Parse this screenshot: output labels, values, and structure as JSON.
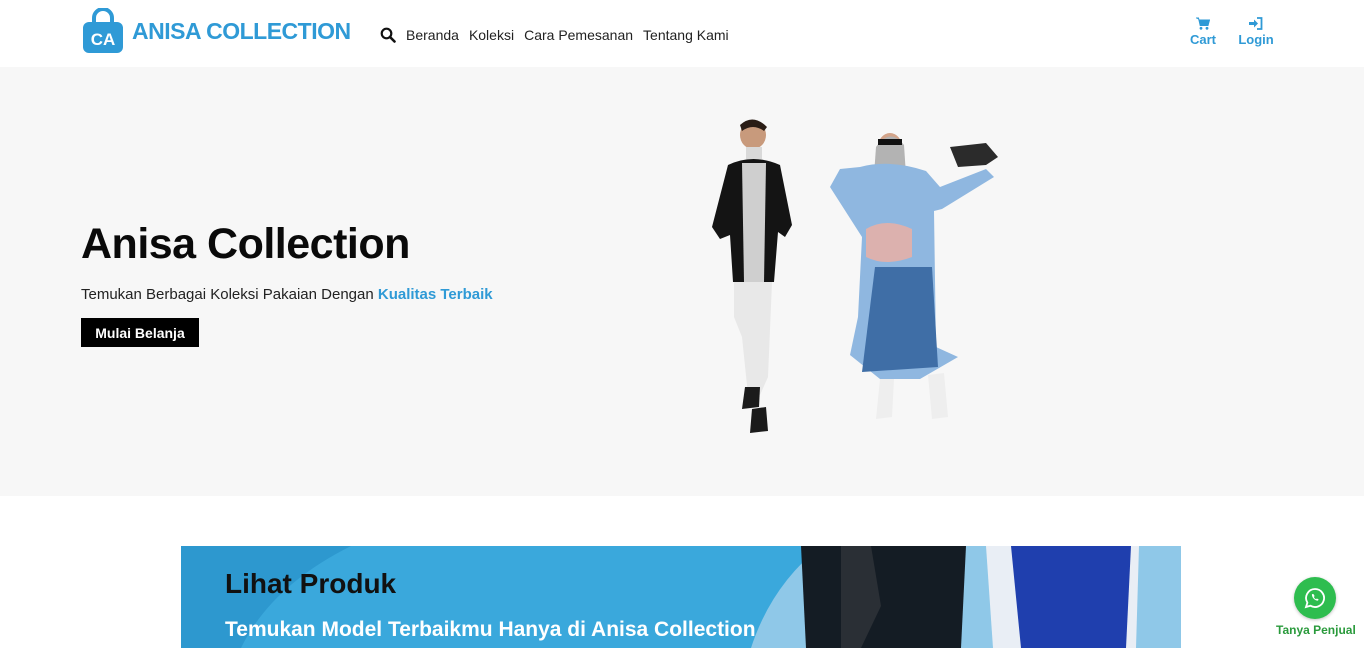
{
  "brand": {
    "name": "ANISA COLLECTION",
    "monogram": "CA",
    "color": "#2f9ad6"
  },
  "nav": {
    "search_icon": "search-icon",
    "items": [
      "Beranda",
      "Koleksi",
      "Cara Pemesanan",
      "Tentang Kami"
    ]
  },
  "actions": {
    "cart": {
      "label": "Cart",
      "icon": "cart-icon"
    },
    "login": {
      "label": "Login",
      "icon": "sign-in-icon"
    }
  },
  "hero": {
    "title": "Anisa Collection",
    "subtitle_prefix": "Temukan Berbagai Koleksi Pakaian Dengan ",
    "subtitle_highlight": "Kualitas Terbaik",
    "cta": "Mulai Belanja",
    "background": "#f7f7f7"
  },
  "banner": {
    "title": "Lihat Produk",
    "subtitle": "Temukan Model Terbaikmu Hanya di Anisa Collection",
    "background": "#3aa8dc"
  },
  "chat": {
    "label": "Tanya Penjual",
    "icon": "whatsapp-icon",
    "color": "#2ebd4f"
  }
}
